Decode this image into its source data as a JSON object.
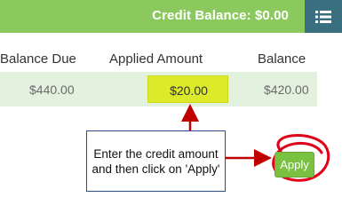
{
  "header": {
    "credit_balance": "Credit Balance: $0.00",
    "menu_icon": "list-icon",
    "background_color": "#8bc95e",
    "menu_button_color": "#3a6f80"
  },
  "table": {
    "columns": [
      "Balance Due",
      "Applied Amount",
      "Balance"
    ],
    "row": {
      "balance_due": "$440.00",
      "applied_amount": "$20.00",
      "balance": "$420.00"
    },
    "row_color": "#e3f1df",
    "highlight_color": "#dcea2a"
  },
  "callout": {
    "text": "Enter the credit amount and then click on 'Apply'",
    "arrow_color": "#c00000",
    "border_color": "#2b4a8c"
  },
  "apply_button": {
    "label": "Apply",
    "color": "#7ac142",
    "circle_color": "#e0001a"
  }
}
